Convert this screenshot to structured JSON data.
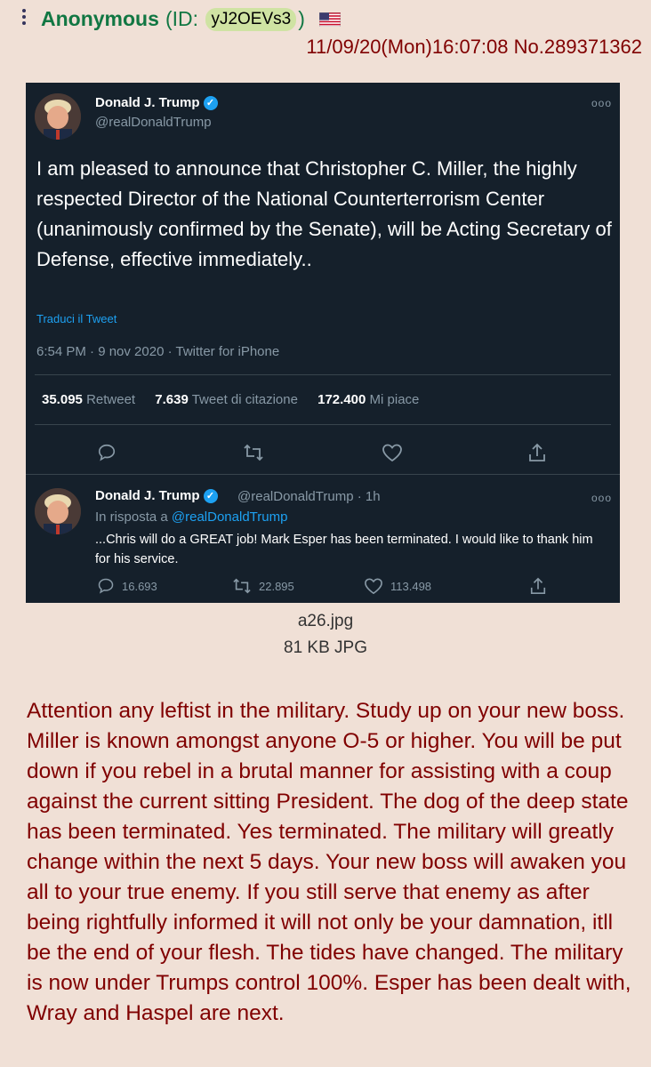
{
  "post": {
    "name": "Anonymous",
    "id_prefix": "(ID:",
    "id": "yJ2OEVs3",
    "id_suffix": ")",
    "flag": "us-flag-icon",
    "datetime": "11/09/20(Mon)16:07:08",
    "number": "No.289371362",
    "comment": "Attention any leftist in the military. Study up on your new boss. Miller is known amongst anyone O-5 or higher. You will be put down if you rebel in a brutal manner for assisting with a coup against the current sitting President. The dog of the deep state has been terminated. Yes terminated. The military will greatly change within the next 5 days. Your new boss will awaken you all to your true enemy. If you still serve that enemy as after being rightfully informed it will not only be your damnation, itll be the end of your flesh. The tides have changed. The military is now under Trumps control 100%. Esper has been dealt with, Wray and Haspel are next."
  },
  "file": {
    "name": "a26.jpg",
    "info": "81 KB JPG"
  },
  "colors": {
    "post_bg": "#f0e0d6",
    "name": "#117743",
    "text": "#800000",
    "tweet_bg": "#15202b",
    "tweet_link": "#1da1f2"
  },
  "tweet": {
    "author": "Donald J. Trump",
    "handle": "@realDonaldTrump",
    "text": "I am pleased to announce that Christopher C. Miller, the highly respected Director of the National Counterterrorism Center (unanimously confirmed by the Senate), will be Acting Secretary of Defense, effective immediately..",
    "translate": "Traduci il Tweet",
    "timestamp": "6:54 PM · 9 nov 2020 · Twitter for iPhone",
    "retweets": "35.095",
    "retweets_label": "Retweet",
    "quotes": "7.639",
    "quotes_label": "Tweet di citazione",
    "likes": "172.400",
    "likes_label": "Mi piace"
  },
  "reply": {
    "author": "Donald J. Trump",
    "handle_time": "@realDonaldTrump · 1h",
    "in_reply_prefix": "In risposta a",
    "in_reply_handle": "@realDonaldTrump",
    "text": "...Chris will do a GREAT job! Mark Esper has been terminated. I would like to thank him for his service.",
    "replies": "16.693",
    "retweets": "22.895",
    "likes": "113.498"
  }
}
